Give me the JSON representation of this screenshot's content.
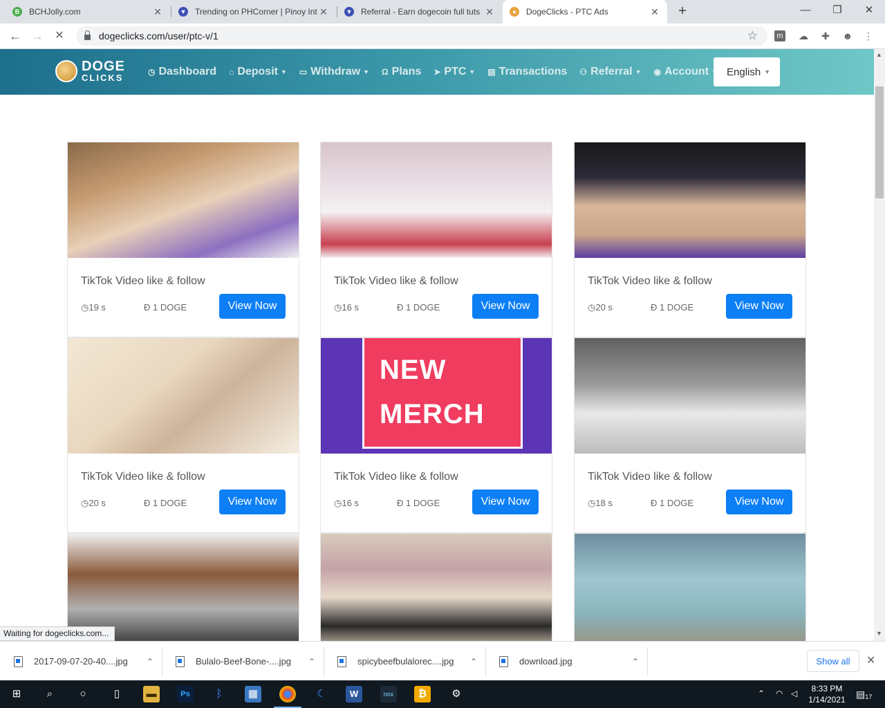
{
  "browser": {
    "tabs": [
      {
        "title": "BCHJolly.com",
        "favicon_color": "#4caf50",
        "favicon_glyph": "B",
        "active": false
      },
      {
        "title": "Trending on PHCorner | Pinoy Int",
        "favicon_color": "#3f51b5",
        "favicon_glyph": "▼",
        "active": false
      },
      {
        "title": "Referral - Earn dogecoin full tuts",
        "favicon_color": "#3f51b5",
        "favicon_glyph": "▼",
        "active": false
      },
      {
        "title": "DogeClicks - PTC Ads",
        "favicon_color": "#e8a33c",
        "favicon_glyph": "●",
        "active": true
      }
    ],
    "new_tab_label": "+",
    "url": "dogeclicks.com/user/ptc-v/1",
    "window_controls": {
      "minimize": "—",
      "maximize": "❐",
      "close": "✕"
    }
  },
  "site": {
    "logo": {
      "line1": "DOGE",
      "line2": "CLICKS"
    },
    "nav": [
      {
        "icon": "dashboard-icon",
        "glyph": "◷",
        "label": "Dashboard",
        "dropdown": false
      },
      {
        "icon": "bank-icon",
        "glyph": "⌂",
        "label": "Deposit",
        "dropdown": true
      },
      {
        "icon": "wallet-icon",
        "glyph": "▭",
        "label": "Withdraw",
        "dropdown": true
      },
      {
        "icon": "omega-icon",
        "glyph": "Ω",
        "label": "Plans",
        "dropdown": false
      },
      {
        "icon": "cursor-icon",
        "glyph": "➤",
        "label": "PTC",
        "dropdown": true
      },
      {
        "icon": "document-icon",
        "glyph": "▤",
        "label": "Transactions",
        "dropdown": false
      },
      {
        "icon": "referral-icon",
        "glyph": "⚇",
        "label": "Referral",
        "dropdown": true
      },
      {
        "icon": "account-icon",
        "glyph": "◉",
        "label": "Account",
        "dropdown": true
      }
    ],
    "language": "English"
  },
  "ads": [
    {
      "title": "TikTok Video like & follow",
      "time": "19 s",
      "reward": "Đ 1 DOGE",
      "button": "View Now",
      "thumb": "t1"
    },
    {
      "title": "TikTok Video like & follow",
      "time": "16 s",
      "reward": "Đ 1 DOGE",
      "button": "View Now",
      "thumb": "t2"
    },
    {
      "title": "TikTok Video like & follow",
      "time": "20 s",
      "reward": "Đ 1 DOGE",
      "button": "View Now",
      "thumb": "t3"
    },
    {
      "title": "TikTok Video like & follow",
      "time": "20 s",
      "reward": "Đ 1 DOGE",
      "button": "View Now",
      "thumb": "t4"
    },
    {
      "title": "TikTok Video like & follow",
      "time": "16 s",
      "reward": "Đ 1 DOGE",
      "button": "View Now",
      "thumb": "t5",
      "thumb_text": [
        "NEW",
        "MERCH"
      ]
    },
    {
      "title": "TikTok Video like & follow",
      "time": "18 s",
      "reward": "Đ 1 DOGE",
      "button": "View Now",
      "thumb": "t6"
    },
    {
      "thumb": "t7"
    },
    {
      "thumb": "t8"
    },
    {
      "thumb": "t9"
    }
  ],
  "status_text": "Waiting for dogeclicks.com...",
  "downloads": [
    {
      "name": "2017-09-07-20-40....jpg"
    },
    {
      "name": "Bulalo-Beef-Bone-....jpg"
    },
    {
      "name": "spicybeefbulalorec....jpg"
    },
    {
      "name": "download.jpg"
    }
  ],
  "show_all_label": "Show all",
  "taskbar": {
    "time": "8:33 PM",
    "date": "1/14/2021",
    "notifications": "17",
    "apps": [
      "windows-start-icon",
      "search-icon",
      "cortana-icon",
      "task-view-icon",
      "file-explorer-icon",
      "photoshop-icon",
      "bluetooth-icon",
      "control-panel-icon",
      "chrome-icon",
      "edge-icon",
      "word-icon",
      "nox-icon",
      "bitcoin-icon",
      "settings-icon"
    ]
  }
}
